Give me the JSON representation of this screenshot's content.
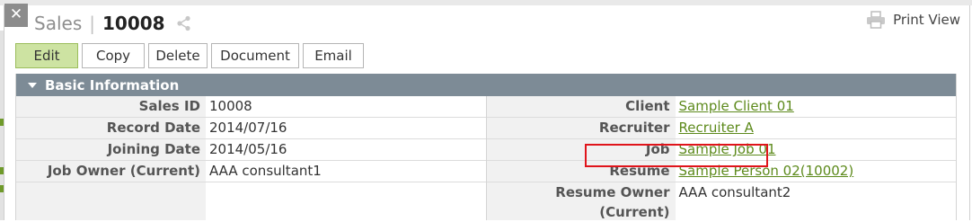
{
  "window": {
    "module": "Sales",
    "separator": "|",
    "record_id": "10008",
    "print_label": "Print View",
    "close_glyph": "✕"
  },
  "toolbar": {
    "edit": "Edit",
    "copy": "Copy",
    "delete": "Delete",
    "document": "Document",
    "email": "Email"
  },
  "section": {
    "title": "Basic Information"
  },
  "left_fields": [
    {
      "label": "Sales ID",
      "value": "10008"
    },
    {
      "label": "Record Date",
      "value": "2014/07/16"
    },
    {
      "label": "Joining Date",
      "value": "2014/05/16"
    },
    {
      "label": "Job Owner (Current)",
      "value": "AAA consultant1"
    }
  ],
  "right_fields": [
    {
      "label": "Client",
      "value": "Sample Client 01"
    },
    {
      "label": "Recruiter",
      "value": "Recruiter A"
    },
    {
      "label": "Job",
      "value": "Sample Job 01"
    },
    {
      "label": "Resume",
      "value": "Sample Person 02(10002)"
    },
    {
      "label": "Resume Owner (Current)",
      "value": "AAA consultant2"
    }
  ],
  "colors": {
    "header_bar": "#7d8b96",
    "link": "#5d8a1c",
    "edit_button": "#cde3a2",
    "highlight": "#e0141b"
  },
  "icons": [
    "close-icon",
    "share-icon",
    "printer-icon",
    "caret-down-icon"
  ]
}
